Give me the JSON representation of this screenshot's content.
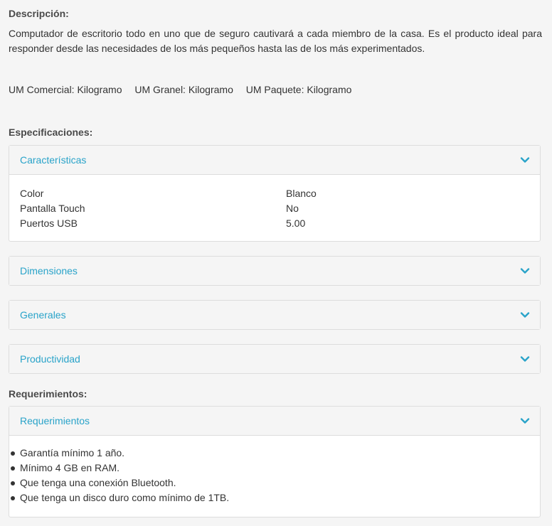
{
  "description": {
    "heading": "Descripción:",
    "text": "Computador de escritorio todo en uno que de seguro cautivará a cada miembro de la casa. Es el producto ideal para responder desde las necesidades de los más pequeños hasta las de los más experimentados."
  },
  "units": {
    "comercial": "UM Comercial: Kilogramo",
    "granel": "UM Granel: Kilogramo",
    "paquete": "UM Paquete: Kilogramo"
  },
  "specifications": {
    "heading": "Especificaciones:",
    "panels": [
      {
        "title": "Características",
        "rows": [
          {
            "label": "Color",
            "value": "Blanco"
          },
          {
            "label": "Pantalla Touch",
            "value": "No"
          },
          {
            "label": "Puertos USB",
            "value": "5.00"
          }
        ]
      },
      {
        "title": "Dimensiones"
      },
      {
        "title": "Generales"
      },
      {
        "title": "Productividad"
      }
    ]
  },
  "requirements": {
    "heading": "Requerimientos:",
    "panel_title": "Requerimientos",
    "items": [
      "Garantía mínimo 1 año.",
      "Mínimo 4 GB en RAM.",
      "Que tenga una conexión Bluetooth.",
      "Que tenga un disco duro como mínimo de 1TB."
    ]
  },
  "colors": {
    "accent": "#29a3c9",
    "panel_header_bg": "#f5f5f5",
    "border": "#dddddd"
  },
  "icons": {
    "chevron": "chevron-down-icon"
  }
}
